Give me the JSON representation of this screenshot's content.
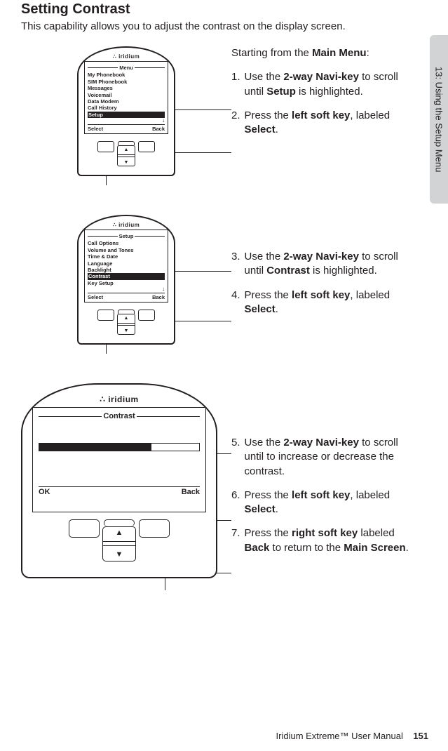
{
  "page": {
    "title": "Setting Contrast",
    "intro": "This capability allows you to adjust the contrast on the display screen.",
    "side_tab": "13: Using the Setup Menu",
    "footer_product": "Iridium Extreme™ User Manual",
    "footer_page": "151",
    "brand": "iridium"
  },
  "phone1": {
    "screen_title": "Menu",
    "items": [
      "My Phonebook",
      "SIM Phonebook",
      "Messages",
      "Voicemail",
      "Data Modem",
      "Call History",
      "Setup"
    ],
    "highlight_index": 6,
    "soft_left": "Select",
    "soft_right": "Back"
  },
  "phone2": {
    "screen_title": "Setup",
    "items": [
      "Call Options",
      "Volume and Tones",
      "Time & Date",
      "Language",
      "Backlight",
      "Contrast",
      "Key Setup"
    ],
    "highlight_index": 5,
    "soft_left": "Select",
    "soft_right": "Back"
  },
  "phone3": {
    "screen_title": "Contrast",
    "soft_left": "OK",
    "soft_right": "Back"
  },
  "steps": {
    "lead": "Starting from the ",
    "lead_bold": "Main Menu",
    "lead_tail": ":",
    "s1_a": "Use the ",
    "s1_b": "2-way Navi-key",
    "s1_c": " to scroll until ",
    "s1_d": "Setup",
    "s1_e": " is highlighted.",
    "s2_a": "Press the ",
    "s2_b": "left soft key",
    "s2_c": ", labeled ",
    "s2_d": "Select",
    "s2_e": ".",
    "s3_a": "Use the ",
    "s3_b": "2-way Navi-key",
    "s3_c": " to scroll until ",
    "s3_d": "Contrast",
    "s3_e": " is highlighted.",
    "s4_a": "Press the ",
    "s4_b": "left soft key",
    "s4_c": ", labeled ",
    "s4_d": "Select",
    "s4_e": ".",
    "s5_a": "Use the ",
    "s5_b": "2-way Navi-key",
    "s5_c": " to scroll until to increase or decrease the contrast.",
    "s6_a": "Press the ",
    "s6_b": "left soft key",
    "s6_c": ", labeled ",
    "s6_d": "Select",
    "s6_e": ".",
    "s7_a": "Press the ",
    "s7_b": "right soft key",
    "s7_c": " labeled ",
    "s7_d": "Back",
    "s7_e": " to return to the ",
    "s7_f": "Main Screen",
    "s7_g": "."
  },
  "nums": {
    "n1": "1.",
    "n2": "2.",
    "n3": "3.",
    "n4": "4.",
    "n5": "5.",
    "n6": "6.",
    "n7": "7."
  }
}
